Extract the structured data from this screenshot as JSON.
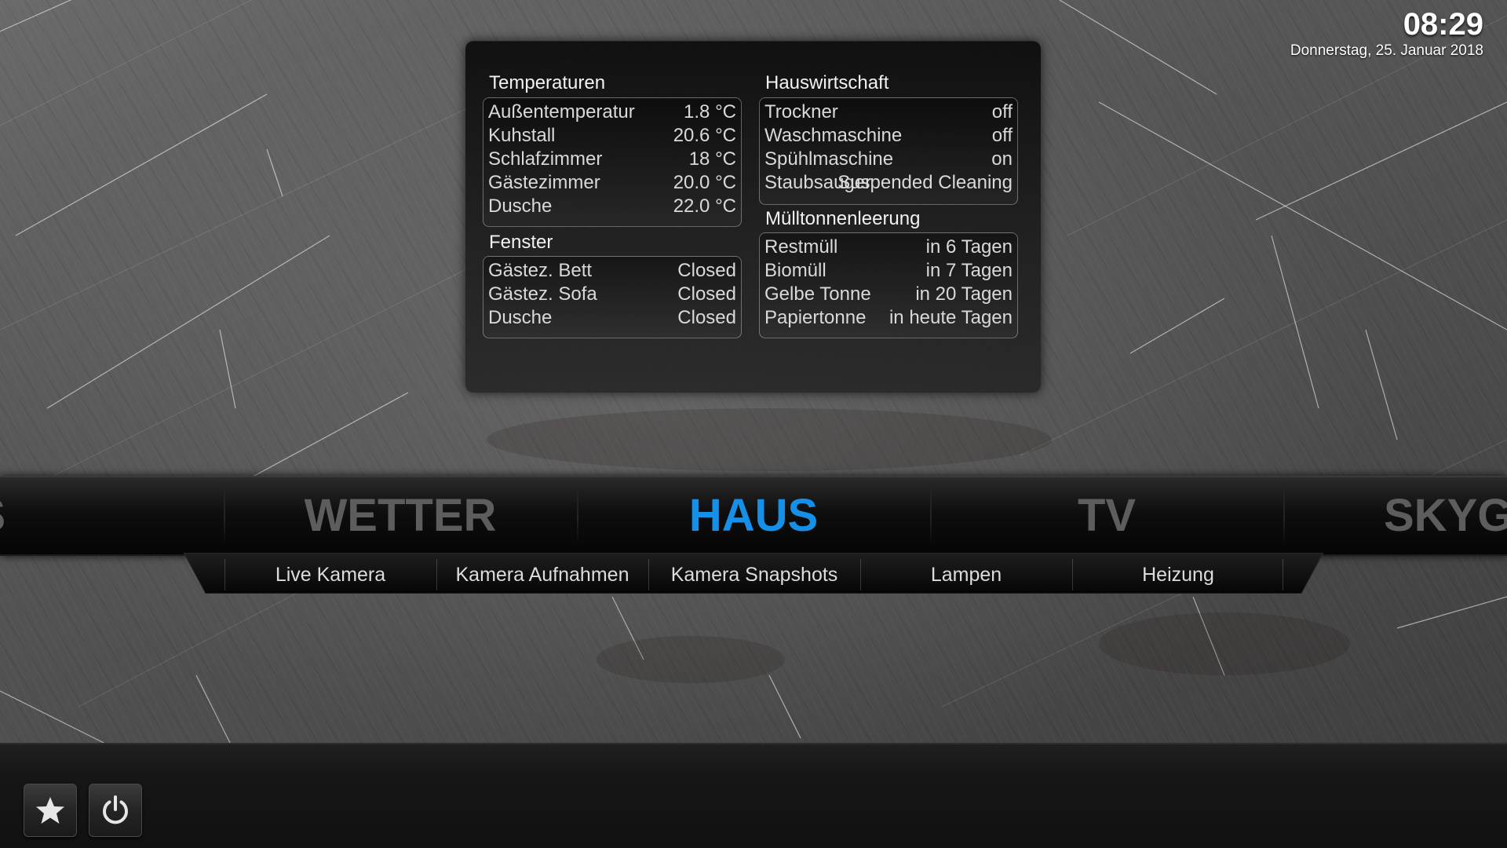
{
  "clock": {
    "time": "08:29",
    "date": "Donnerstag, 25. Januar 2018"
  },
  "panel": {
    "temperatures": {
      "title": "Temperaturen",
      "rows": [
        {
          "label": "Außentemperatur",
          "value": "1.8 °C"
        },
        {
          "label": "Kuhstall",
          "value": "20.6 °C"
        },
        {
          "label": "Schlafzimmer",
          "value": "18 °C"
        },
        {
          "label": "Gästezimmer",
          "value": "20.0 °C"
        },
        {
          "label": "Dusche",
          "value": "22.0 °C"
        }
      ]
    },
    "windows": {
      "title": "Fenster",
      "rows": [
        {
          "label": "Gästez. Bett",
          "value": "Closed"
        },
        {
          "label": "Gästez. Sofa",
          "value": "Closed"
        },
        {
          "label": "Dusche",
          "value": "Closed"
        }
      ]
    },
    "household": {
      "title": "Hauswirtschaft",
      "rows": [
        {
          "label": "Trockner",
          "value": "off"
        },
        {
          "label": "Waschmaschine",
          "value": "off"
        },
        {
          "label": "Spühlmaschine",
          "value": "on"
        },
        {
          "label": "Staubsauger",
          "value": "Suspended Cleaning"
        }
      ]
    },
    "trash": {
      "title": "Mülltonnenleerung",
      "rows": [
        {
          "label": "Restmüll",
          "value": "in 6 Tagen"
        },
        {
          "label": "Biomüll",
          "value": "in 7 Tagen"
        },
        {
          "label": "Gelbe Tonne",
          "value": "in 20 Tagen"
        },
        {
          "label": "Papiertonne",
          "value": "in heute Tagen"
        }
      ]
    }
  },
  "main_menu": {
    "items": [
      "NEWS",
      "WETTER",
      "HAUS",
      "TV",
      "SKYGO"
    ],
    "active": "HAUS",
    "active_color": "#168fe8",
    "inactive_color": "#5d5d5d"
  },
  "submenu": {
    "items": [
      "Live Kamera",
      "Kamera Aufnahmen",
      "Kamera Snapshots",
      "Lampen",
      "Heizung"
    ]
  },
  "bottom_bar": {
    "buttons": [
      {
        "name": "favourites",
        "icon": "star-icon"
      },
      {
        "name": "power",
        "icon": "power-icon"
      }
    ]
  }
}
